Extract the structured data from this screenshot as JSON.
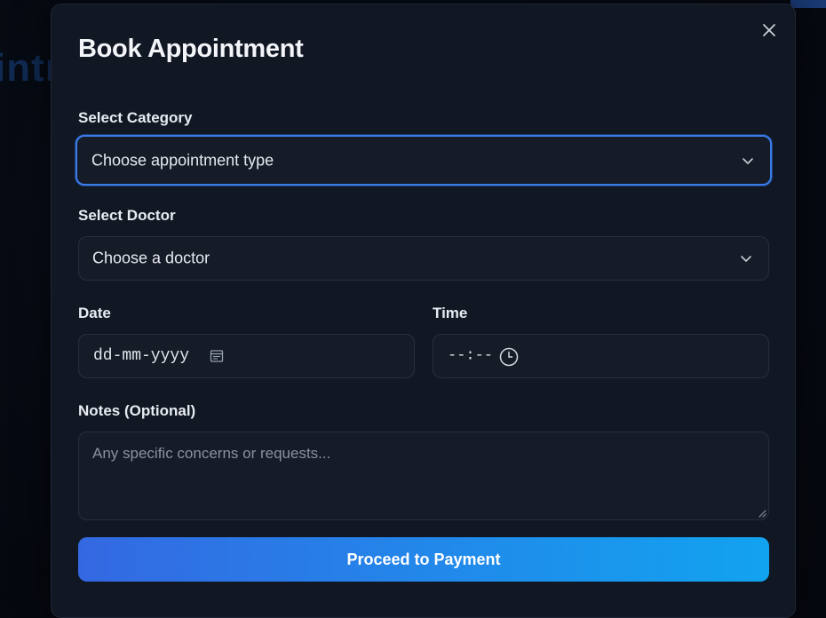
{
  "background": {
    "partial_text": "intr"
  },
  "modal": {
    "title": "Book Appointment",
    "close_icon": "close-icon"
  },
  "category": {
    "label": "Select Category",
    "value": "Choose appointment type"
  },
  "doctor": {
    "label": "Select Doctor",
    "value": "Choose a doctor"
  },
  "date": {
    "label": "Date",
    "value": "dd-mm-yyyy",
    "icon": "calendar-icon"
  },
  "time": {
    "label": "Time",
    "value": "--:--",
    "icon": "clock-icon"
  },
  "notes": {
    "label": "Notes (Optional)",
    "placeholder": "Any specific concerns or requests..."
  },
  "submit": {
    "label": "Proceed to Payment"
  },
  "colors": {
    "accent": "#3b7be8",
    "button_gradient_start": "#3468e2",
    "button_gradient_end": "#12a3ef",
    "modal_bg": "#111723"
  }
}
